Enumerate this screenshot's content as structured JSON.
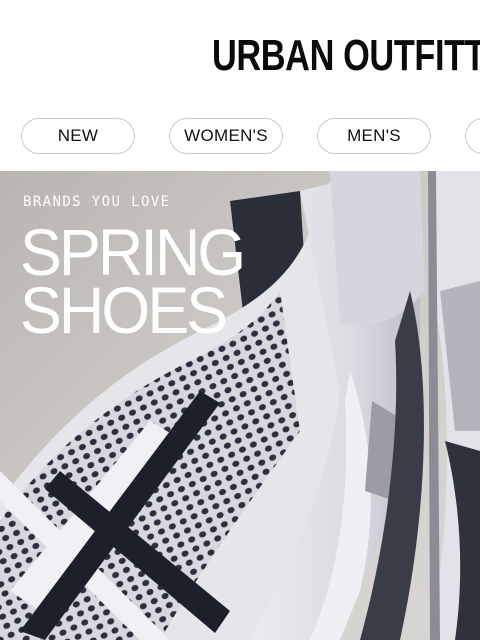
{
  "header": {
    "logo_text": "URBAN OUTFITTERS"
  },
  "nav": {
    "categories": [
      {
        "label": "NEW"
      },
      {
        "label": "WOMEN'S"
      },
      {
        "label": "MEN'S"
      },
      {
        "label": ""
      }
    ]
  },
  "hero": {
    "eyebrow": "BRANDS YOU LOVE",
    "headline_line1": "SPRING",
    "headline_line2": "SHOES",
    "text_color": "#ffffff",
    "background_color": "#c9c7c4"
  }
}
